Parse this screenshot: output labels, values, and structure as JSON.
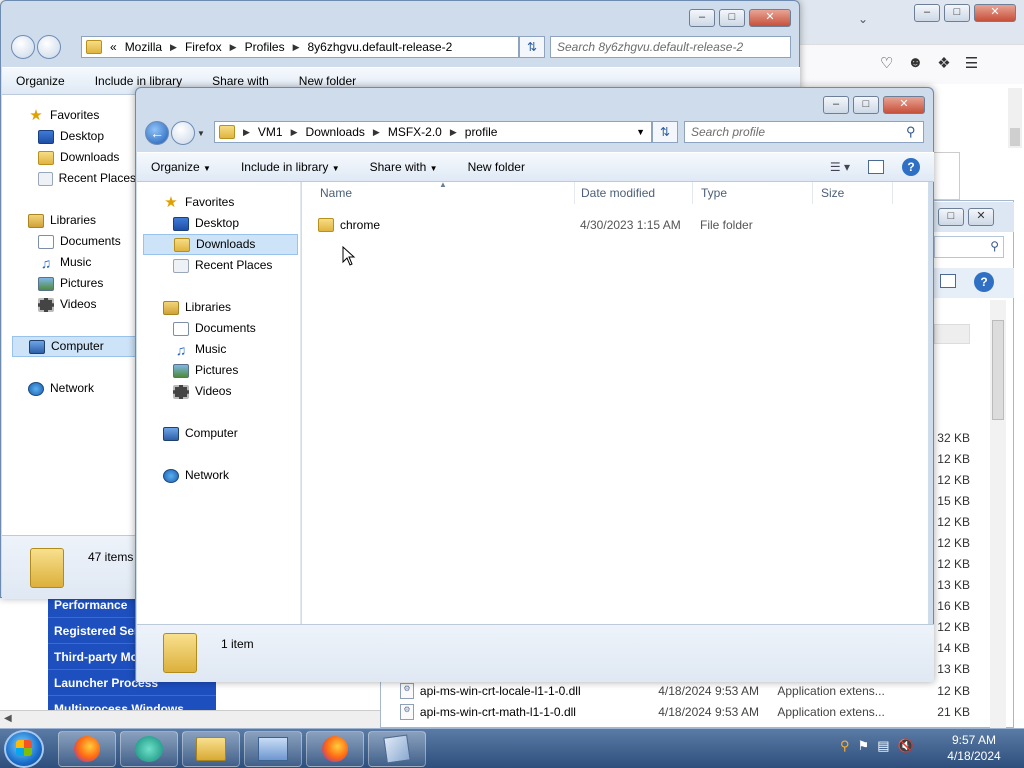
{
  "browser": {
    "controls": [
      "–",
      "□",
      "✕"
    ]
  },
  "services": [
    "Performance",
    "Registered Services",
    "Third-party Modules",
    "Launcher Process",
    "Multiprocess Windows"
  ],
  "bg_files": {
    "sizes": [
      "32 KB",
      "12 KB",
      "12 KB",
      "15 KB",
      "12 KB",
      "12 KB",
      "12 KB",
      "13 KB",
      "16 KB",
      "12 KB",
      "14 KB",
      "13 KB"
    ],
    "rows": [
      {
        "name": "api-ms-win-crt-locale-l1-1-0.dll",
        "date": "4/18/2024 9:53 AM",
        "type": "Application extens...",
        "size": "12 KB"
      },
      {
        "name": "api-ms-win-crt-math-l1-1-0.dll",
        "date": "4/18/2024 9:53 AM",
        "type": "Application extens...",
        "size": "21 KB"
      }
    ]
  },
  "win1": {
    "path": [
      "Mozilla",
      "Firefox",
      "Profiles",
      "8y6zhgvu.default-release-2"
    ],
    "overflow": "«",
    "search_placeholder": "Search 8y6zhgvu.default-release-2",
    "commands": [
      "Organize",
      "Include in library",
      "Share with",
      "New folder"
    ],
    "nav": {
      "favorites": "Favorites",
      "fav_items": [
        "Desktop",
        "Downloads",
        "Recent Places"
      ],
      "libraries": "Libraries",
      "lib_items": [
        "Documents",
        "Music",
        "Pictures",
        "Videos"
      ],
      "computer": "Computer",
      "network": "Network"
    },
    "status": "47 items"
  },
  "win2": {
    "path": [
      "VM1",
      "Downloads",
      "MSFX-2.0",
      "profile"
    ],
    "search_placeholder": "Search profile",
    "commands": [
      "Organize",
      "Include in library",
      "Share with",
      "New folder"
    ],
    "nav": {
      "favorites": "Favorites",
      "fav_items": [
        "Desktop",
        "Downloads",
        "Recent Places"
      ],
      "libraries": "Libraries",
      "lib_items": [
        "Documents",
        "Music",
        "Pictures",
        "Videos"
      ],
      "computer": "Computer",
      "network": "Network"
    },
    "columns": [
      "Name",
      "Date modified",
      "Type",
      "Size"
    ],
    "files": [
      {
        "name": "chrome",
        "date": "4/30/2023 1:15 AM",
        "type": "File folder",
        "size": ""
      }
    ],
    "status": "1 item"
  },
  "taskbar": {
    "time": "9:57 AM",
    "date": "4/18/2024"
  }
}
